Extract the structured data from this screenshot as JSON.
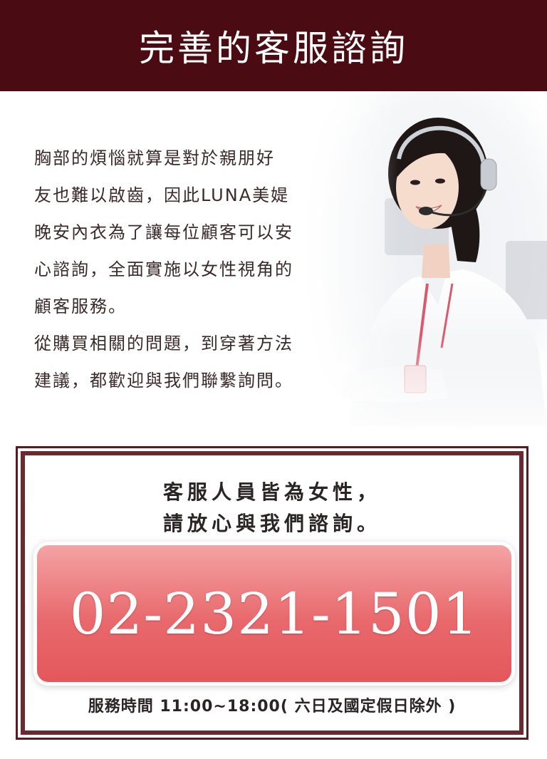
{
  "header": {
    "title": "完善的客服諮詢"
  },
  "intro": {
    "lines": [
      "胸部的煩惱就算是對於親朋好",
      "友也難以啟齒，因此LUNA美媞",
      "晚安內衣為了讓每位顧客可以安",
      "心諮詢，全面實施以女性視角的",
      "顧客服務。",
      "從購買相關的問題，到穿著方法",
      "建議，都歡迎與我們聯繫詢問。"
    ]
  },
  "contact": {
    "heading_line1": "客服人員皆為女性，",
    "heading_line2": "請放心與我們諮詢。",
    "phone": "02-2321-1501",
    "hours": "服務時間 11:00~18:00( 六日及國定假日除外 )"
  },
  "colors": {
    "header_bg": "#4a0b12",
    "border": "#5a1a22",
    "button_top": "#f4a3a4",
    "button_bottom": "#e4575b"
  }
}
